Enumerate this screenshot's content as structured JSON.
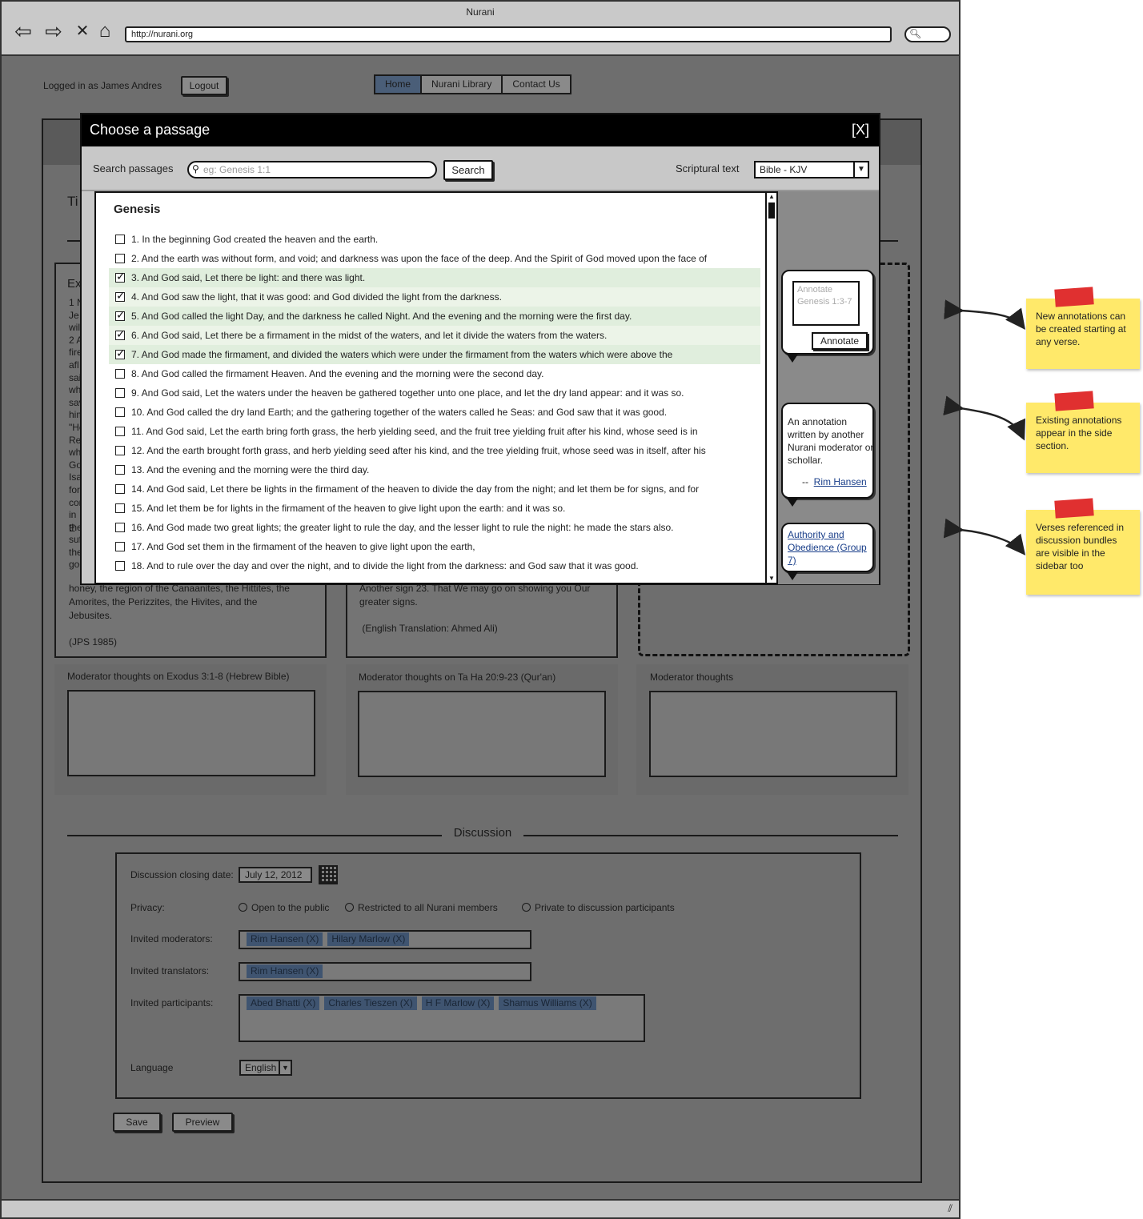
{
  "browser": {
    "title": "Nurani",
    "url": "http://nurani.org"
  },
  "page": {
    "logged_in_text": "Logged in as James Andres",
    "logout_label": "Logout",
    "nav": [
      {
        "label": "Home",
        "active": true
      },
      {
        "label": "Nurani Library",
        "active": false
      },
      {
        "label": "Contact Us",
        "active": false
      }
    ],
    "left_pane_peek": [
      "Ti",
      "Ex",
      "1 N",
      "Je",
      "wil",
      "2 A",
      "fire",
      "afl",
      "sai",
      "why",
      "sav",
      "him",
      "\"He",
      "Re",
      "whi",
      "Go",
      "Isa",
      "for",
      "cor",
      "in E",
      "the",
      "suf",
      "the",
      "goo"
    ],
    "left_pane_tail": [
      "honey, the region of the Canaanites, the Hittites, the",
      "Amorites, the Perizzites, the Hivites, and the",
      "Jebusites.",
      "",
      "(JPS 1985)"
    ],
    "middle_pane_tail": [
      "Another sign 23. That We may go on showing you Our",
      "greater signs.",
      "",
      " (English Translation: Ahmed Ali)"
    ],
    "moderator_labels": [
      "Moderator thoughts on Exodus 3:1-8 (Hebrew Bible)",
      "Moderator thoughts on Ta Ha 20:9-23 (Qur'an)",
      "Moderator thoughts"
    ],
    "discussion": {
      "title": "Discussion",
      "closing_date_label": "Discussion closing date:",
      "closing_date": "July 12, 2012",
      "privacy_label": "Privacy:",
      "privacy_options": [
        "Open to the public",
        "Restricted to all Nurani members",
        "Private to discussion participants"
      ],
      "moderators_label": "Invited moderators:",
      "moderators": [
        "Rim Hansen (X)",
        "Hilary Marlow (X)"
      ],
      "translators_label": "Invited translators:",
      "translators": [
        "Rim Hansen (X)"
      ],
      "participants_label": "Invited participants:",
      "participants": [
        "Abed Bhatti (X)",
        "Charles Tieszen (X)",
        "H F Marlow (X)",
        "Shamus Williams (X)"
      ],
      "language_label": "Language",
      "language": "English"
    },
    "save_label": "Save",
    "preview_label": "Preview"
  },
  "modal": {
    "title": "Choose a passage",
    "close_label": "[X]",
    "search_label": "Search passages",
    "search_placeholder": "eg: Genesis 1:1",
    "search_button": "Search",
    "scriptural_label": "Scriptural text",
    "scriptural_value": "Bible - KJV",
    "book": "Genesis",
    "verses": [
      {
        "text": "1. In the beginning God created the heaven and the earth.",
        "checked": false
      },
      {
        "text": "2.  And the earth was without form, and void; and darkness was upon the face of the deep. And the Spirit of God moved upon the face of",
        "checked": false
      },
      {
        "text": "3. And God said, Let there be light: and there was light.",
        "checked": true
      },
      {
        "text": "4. And God saw the light, that it was good: and God divided the light from the darkness.",
        "checked": true
      },
      {
        "text": "5. And God called the light Day, and the darkness he called Night. And the evening and the morning were the first day.",
        "checked": true
      },
      {
        "text": "6. And God said, Let there be a firmament in the midst of the waters, and let it divide the waters from the waters.",
        "checked": true
      },
      {
        "text": "7. And God made the firmament, and divided the waters which were under the firmament from the waters which were above the",
        "checked": true
      },
      {
        "text": "8. And God called the firmament Heaven. And the evening and the morning were the second day.",
        "checked": false
      },
      {
        "text": "9. And God said, Let the waters under the heaven be gathered together unto one place, and let the dry land appear: and it was so.",
        "checked": false
      },
      {
        "text": "10. And God called the dry land Earth; and the gathering together of the waters called he Seas: and God saw that it was good.",
        "checked": false
      },
      {
        "text": "11. And God said, Let the earth bring forth grass, the herb yielding seed, and the fruit tree yielding fruit after his kind, whose seed is in",
        "checked": false
      },
      {
        "text": "12. And the earth brought forth grass, and herb yielding seed after his kind, and the tree yielding fruit, whose seed was in itself, after his",
        "checked": false
      },
      {
        "text": "13. And the evening and the morning were the third day.",
        "checked": false
      },
      {
        "text": "14. And God said, Let there be lights in the firmament of the heaven to divide the day from the night; and let them be for signs, and for",
        "checked": false
      },
      {
        "text": "15. And let them be for lights in the firmament of the heaven to give light upon the earth: and it was so.",
        "checked": false
      },
      {
        "text": "16. And God made two great lights; the greater light to rule the day, and the lesser light to rule the night: he made the stars also.",
        "checked": false
      },
      {
        "text": "17. And God set them in the firmament of the heaven to give light upon the earth,",
        "checked": false
      },
      {
        "text": "18. And to rule over the day and over the night, and to divide the light from the darkness: and God saw that it was good.",
        "checked": false
      }
    ],
    "annotate_placeholder": "Annotate Genesis 1:3-7",
    "annotate_button": "Annotate",
    "annotation_text": "An annotation written by another Nurani moderator or schollar.",
    "annotation_dash": "--",
    "annotation_author": "Rim Hansen",
    "bundle_link": "Authority and Obedience (Group 7)"
  },
  "notes": [
    "New annotations can be created starting at any verse.",
    "Existing annotations appear in the side section.",
    "Verses referenced in discussion bundles are visible in the sidebar too"
  ],
  "colors": {
    "modal_header": "#000000",
    "selected_verse": "#e0eedd",
    "sticky_note": "#ffe96a",
    "tape": "#e03030",
    "tag": "#3f5470"
  }
}
